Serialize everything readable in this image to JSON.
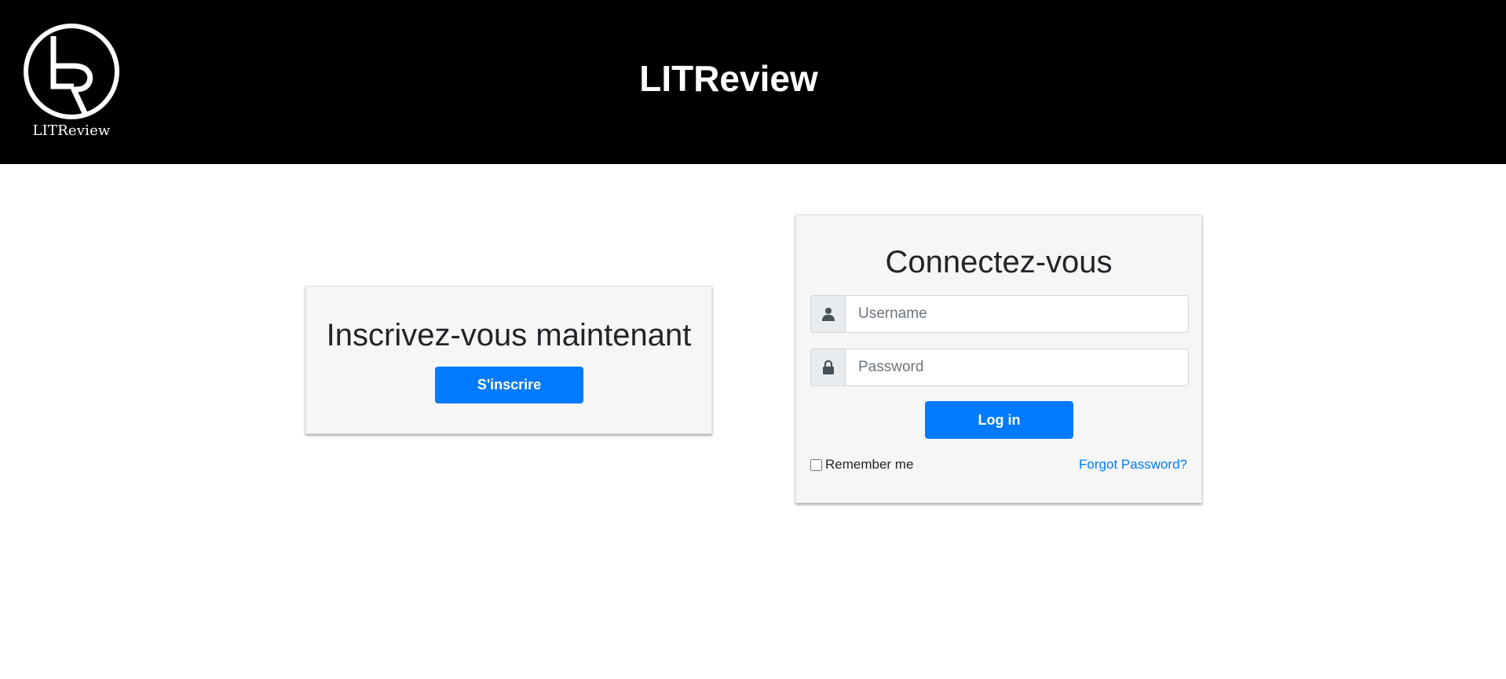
{
  "header": {
    "logo_caption": "LITReview",
    "site_title": "LITReview"
  },
  "signup": {
    "title": "Inscrivez-vous maintenant",
    "button_label": "S'inscrire"
  },
  "login": {
    "title": "Connectez-vous",
    "username_placeholder": "Username",
    "username_value": "",
    "password_placeholder": "Password",
    "password_value": "",
    "button_label": "Log in",
    "remember_label": "Remember me",
    "remember_checked": false,
    "forgot_label": "Forgot Password?"
  },
  "icons": {
    "logo": "lr-monogram-logo",
    "username": "user-icon",
    "password": "lock-icon"
  },
  "colors": {
    "header_bg": "#000000",
    "primary": "#007bff",
    "card_bg": "#f6f6f6",
    "addon_bg": "#e9ecef",
    "icon": "#495057"
  }
}
